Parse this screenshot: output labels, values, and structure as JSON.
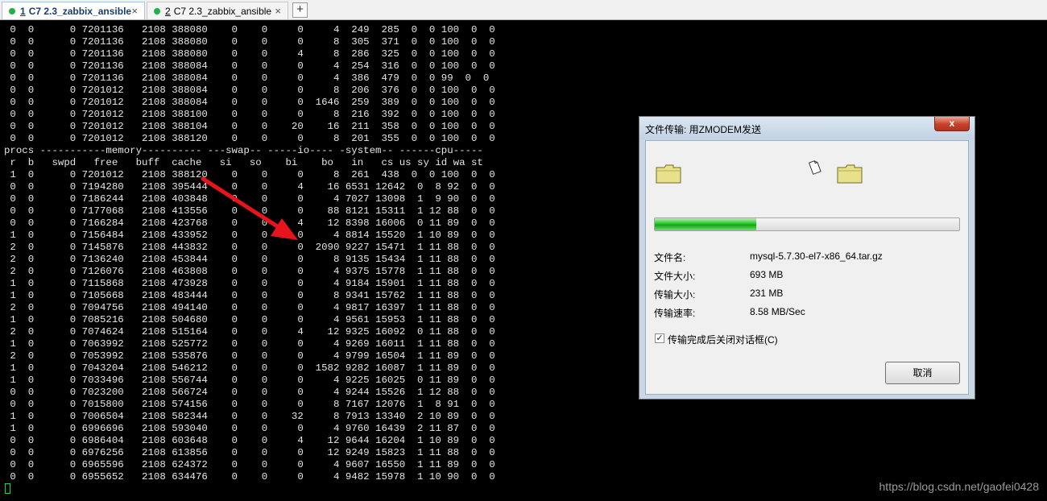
{
  "tabs": [
    {
      "number": "1",
      "label": "C7 2.3_zabbix_ansible",
      "active": true
    },
    {
      "number": "2",
      "label": "C7 2.3_zabbix_ansible",
      "active": false
    }
  ],
  "tab_close_glyph": "×",
  "tab_add_glyph": "+",
  "colors": {
    "tab_status_dot": "#21b14a",
    "terminal_bg": "#000000",
    "terminal_text": "#e6e6e6",
    "arrow": "#e8141c",
    "progress": "#28c528",
    "cursor": "#27d04a"
  },
  "terminal": {
    "lines": [
      " 0  0      0 7201136   2108 388080    0    0     0     4  249  285  0  0 100  0  0",
      " 0  0      0 7201136   2108 388080    0    0     0     8  305  371  0  0 100  0  0",
      " 0  0      0 7201136   2108 388080    0    0     4     8  286  325  0  0 100  0  0",
      " 0  0      0 7201136   2108 388084    0    0     0     4  254  316  0  0 100  0  0",
      " 0  0      0 7201136   2108 388084    0    0     0     4  386  479  0  0 99  0  0",
      " 0  0      0 7201012   2108 388084    0    0     0     8  206  376  0  0 100  0  0",
      " 0  0      0 7201012   2108 388084    0    0     0  1646  259  389  0  0 100  0  0",
      " 0  0      0 7201012   2108 388100    0    0     0     8  216  392  0  0 100  0  0",
      " 0  0      0 7201012   2108 388104    0    0    20    16  211  358  0  0 100  0  0",
      " 0  0      0 7201012   2108 388120    0    0     0     8  201  355  0  0 100  0  0",
      "procs -----------memory---------- ---swap-- -----io---- -system-- ------cpu-----",
      " r  b   swpd   free   buff  cache   si   so    bi    bo   in   cs us sy id wa st",
      " 1  0      0 7201012   2108 388120    0    0     0     8  261  438  0  0 100  0  0",
      " 0  0      0 7194280   2108 395444    0    0     4    16 6531 12642  0  8 92  0  0",
      " 0  0      0 7186244   2108 403848    0    0     0     4 7027 13098  1  9 90  0  0",
      " 0  0      0 7177068   2108 413556    0    0     0    88 8121 15311  1 12 88  0  0",
      " 0  0      0 7166284   2108 423768    0    0     4    12 8398 16006  0 11 89  0  0",
      " 1  0      0 7156484   2108 433952    0    0     0     4 8814 15520  1 10 89  0  0",
      " 2  0      0 7145876   2108 443832    0    0     0  2090 9227 15471  1 11 88  0  0",
      " 2  0      0 7136240   2108 453844    0    0     0     8 9135 15434  1 11 88  0  0",
      " 2  0      0 7126076   2108 463808    0    0     0     4 9375 15778  1 11 88  0  0",
      " 1  0      0 7115868   2108 473928    0    0     0     4 9184 15901  1 11 88  0  0",
      " 1  0      0 7105668   2108 483444    0    0     0     8 9341 15762  1 11 88  0  0",
      " 2  0      0 7094756   2108 494140    0    0     0     4 9817 16397  1 11 88  0  0",
      " 1  0      0 7085216   2108 504680    0    0     0     4 9561 15953  1 11 88  0  0",
      " 2  0      0 7074624   2108 515164    0    0     4    12 9325 16092  0 11 88  0  0",
      " 1  0      0 7063992   2108 525772    0    0     0     4 9269 16011  1 11 88  0  0",
      " 2  0      0 7053992   2108 535876    0    0     0     4 9799 16504  1 11 89  0  0",
      " 1  0      0 7043204   2108 546212    0    0     0  1582 9282 16087  1 11 89  0  0",
      " 1  0      0 7033496   2108 556744    0    0     0     4 9225 16025  0 11 89  0  0",
      " 0  0      0 7023200   2108 566724    0    0     0     4 9244 15526  1 12 88  0  0",
      " 0  0      0 7015800   2108 574156    0    0     0     8 7167 12076  1  8 91  0  0",
      " 1  0      0 7006504   2108 582344    0    0    32     8 7913 13340  2 10 89  0  0",
      " 1  0      0 6996696   2108 593040    0    0     0     4 9760 16439  2 11 87  0  0",
      " 0  0      0 6986404   2108 603648    0    0     4    12 9644 16204  1 10 89  0  0",
      " 0  0      0 6976256   2108 613856    0    0     0    12 9249 15823  1 11 88  0  0",
      " 0  0      0 6965596   2108 624372    0    0     0     4 9607 16550  1 11 89  0  0",
      " 0  0      0 6955652   2108 634476    0    0     0     4 9482 15978  1 10 90  0  0"
    ]
  },
  "watermark": "https://blog.csdn.net/gaofei0428",
  "dialog": {
    "title": "文件传输: 用ZMODEM发送",
    "close_glyph": "x",
    "icons": [
      "folder-icon",
      "file-icon",
      "folder-icon"
    ],
    "progress_fraction": 0.333,
    "fields": [
      {
        "label": "文件名:",
        "value": "mysql-5.7.30-el7-x86_64.tar.gz"
      },
      {
        "label": "文件大小:",
        "value": "693 MB"
      },
      {
        "label": "传输大小:",
        "value": "231 MB"
      },
      {
        "label": "传输速率:",
        "value": "8.58 MB/Sec"
      }
    ],
    "checkbox_label": "传输完成后关闭对话框(C)",
    "checkbox_checked": true,
    "checkbox_glyph": "✓",
    "cancel_label": "取消"
  }
}
